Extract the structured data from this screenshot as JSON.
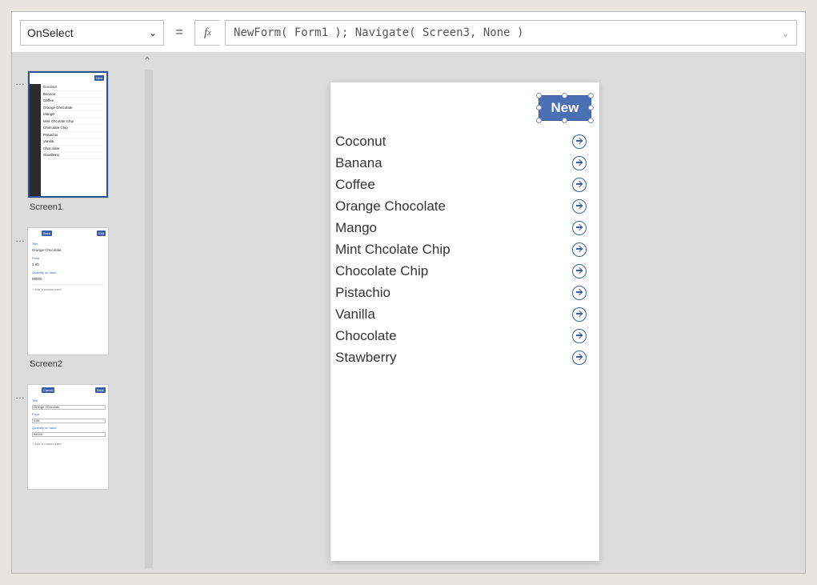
{
  "formula": {
    "property": "OnSelect",
    "expression": "NewForm( Form1 ); Navigate( Screen3, None )"
  },
  "thumbs": {
    "screen1_label": "Screen1",
    "screen2_label": "Screen2",
    "new_btn": "New",
    "back_btn": "Back",
    "edit_btn": "Edit",
    "cancel_btn": "Cancel",
    "save_btn": "Save",
    "form_title_lbl": "Title",
    "form_title_val": "Orange Chocolate",
    "form_price_lbl": "Price",
    "form_price_val": "3.80",
    "form_qty_lbl": "Quantity on hand",
    "form_qty_val": "98000",
    "form_add": "+  Add a custom card",
    "s1_items": [
      "Coconut",
      "Banana",
      "Coffee",
      "Orange Chocolate",
      "Mango",
      "Mint Chcolate Chip",
      "Chocolate Chip",
      "Pistachio",
      "Vanilla",
      "Chocolate",
      "Stawberry"
    ]
  },
  "canvas": {
    "new_btn": "New",
    "items": [
      "Coconut",
      "Banana",
      "Coffee",
      "Orange Chocolate",
      "Mango",
      "Mint Chcolate Chip",
      "Chocolate Chip",
      "Pistachio",
      "Vanilla",
      "Chocolate",
      "Stawberry"
    ]
  }
}
